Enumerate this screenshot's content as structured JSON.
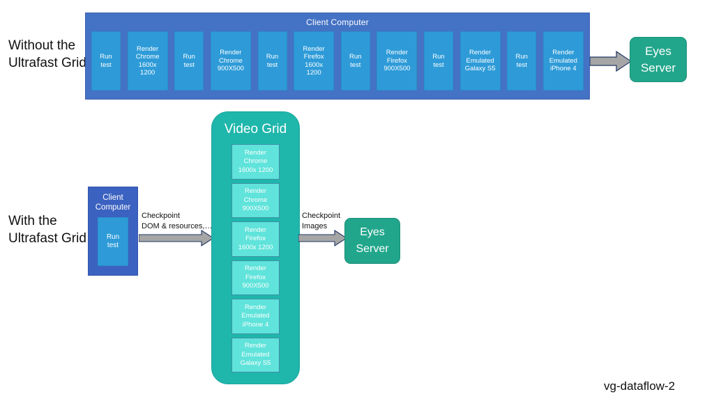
{
  "labels": {
    "without_grid": "Without the\nUltrafast Grid",
    "with_grid": "With the\nUltrafast Grid"
  },
  "top_section": {
    "client_bar_title": "Client Computer",
    "tasks": [
      {
        "kind": "run",
        "text": "Run\ntest"
      },
      {
        "kind": "render",
        "text": "Render\nChrome\n1600x\n1200"
      },
      {
        "kind": "run",
        "text": "Run\ntest"
      },
      {
        "kind": "render",
        "text": "Render\nChrome\n900X500"
      },
      {
        "kind": "run",
        "text": "Run\ntest"
      },
      {
        "kind": "render",
        "text": "Render\nFirefox\n1600x\n1200"
      },
      {
        "kind": "run",
        "text": "Run\ntest"
      },
      {
        "kind": "render",
        "text": "Render\nFirefox\n900X500"
      },
      {
        "kind": "run",
        "text": "Run\ntest"
      },
      {
        "kind": "render",
        "text": "Render\nEmulated Galaxy S5"
      },
      {
        "kind": "run",
        "text": "Run\ntest"
      },
      {
        "kind": "render",
        "text": "Render\nEmulated iPhone 4"
      }
    ],
    "eyes_server_label": "Eyes\nServer"
  },
  "bottom_section": {
    "client_box_title": "Client\nComputer",
    "client_box_inner_label": "Run\ntest",
    "arrow1_label": "Checkpoint\nDOM & resources,…",
    "video_grid_title": "Video Grid",
    "render_boxes": [
      {
        "text": "Render\nChrome\n1600x 1200"
      },
      {
        "text": "Render\nChrome\n900X500"
      },
      {
        "text": "Render\nFirefox\n1600x 1200"
      },
      {
        "text": "Render\nFirefox\n900X500"
      },
      {
        "text": "Render\nEmulated\niPhone 4"
      },
      {
        "text": "Render\nEmulated\nGalaxy S5"
      }
    ],
    "arrow2_label": "Checkpoint\nImages",
    "eyes_server_label": "Eyes\nServer"
  },
  "caption": "vg-dataflow-2",
  "colors": {
    "client_bar_blue": "#4472C4",
    "task_blue": "#2E9BD8",
    "eyes_green": "#21A68B",
    "video_grid_teal": "#1FB6AB",
    "render_cyan": "#5FE3DA",
    "arrow_gray": "#A6A6A6",
    "arrow_outline": "#1F3864"
  }
}
